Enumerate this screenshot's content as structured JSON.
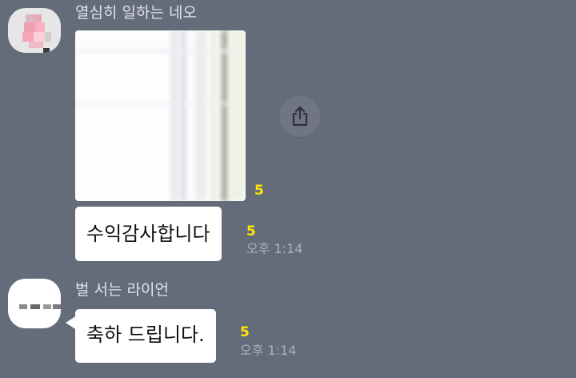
{
  "messages": [
    {
      "sender": "열심히 일하는 네오",
      "image_unread": "5",
      "text": "수익감사합니다",
      "text_unread": "5",
      "time": "오후 1:14"
    },
    {
      "sender": "벌 서는 라이언",
      "text": "축하 드립니다.",
      "text_unread": "5",
      "time": "오후 1:14"
    }
  ],
  "icons": {
    "share": "share-icon",
    "avatar_neo": "avatar-icon",
    "avatar_ryan": "avatar-icon"
  },
  "colors": {
    "background": "#646b79",
    "bubble": "#ffffff",
    "unread": "#ffe600",
    "timestamp": "#aab0bb",
    "sender": "#dfe3ea"
  }
}
